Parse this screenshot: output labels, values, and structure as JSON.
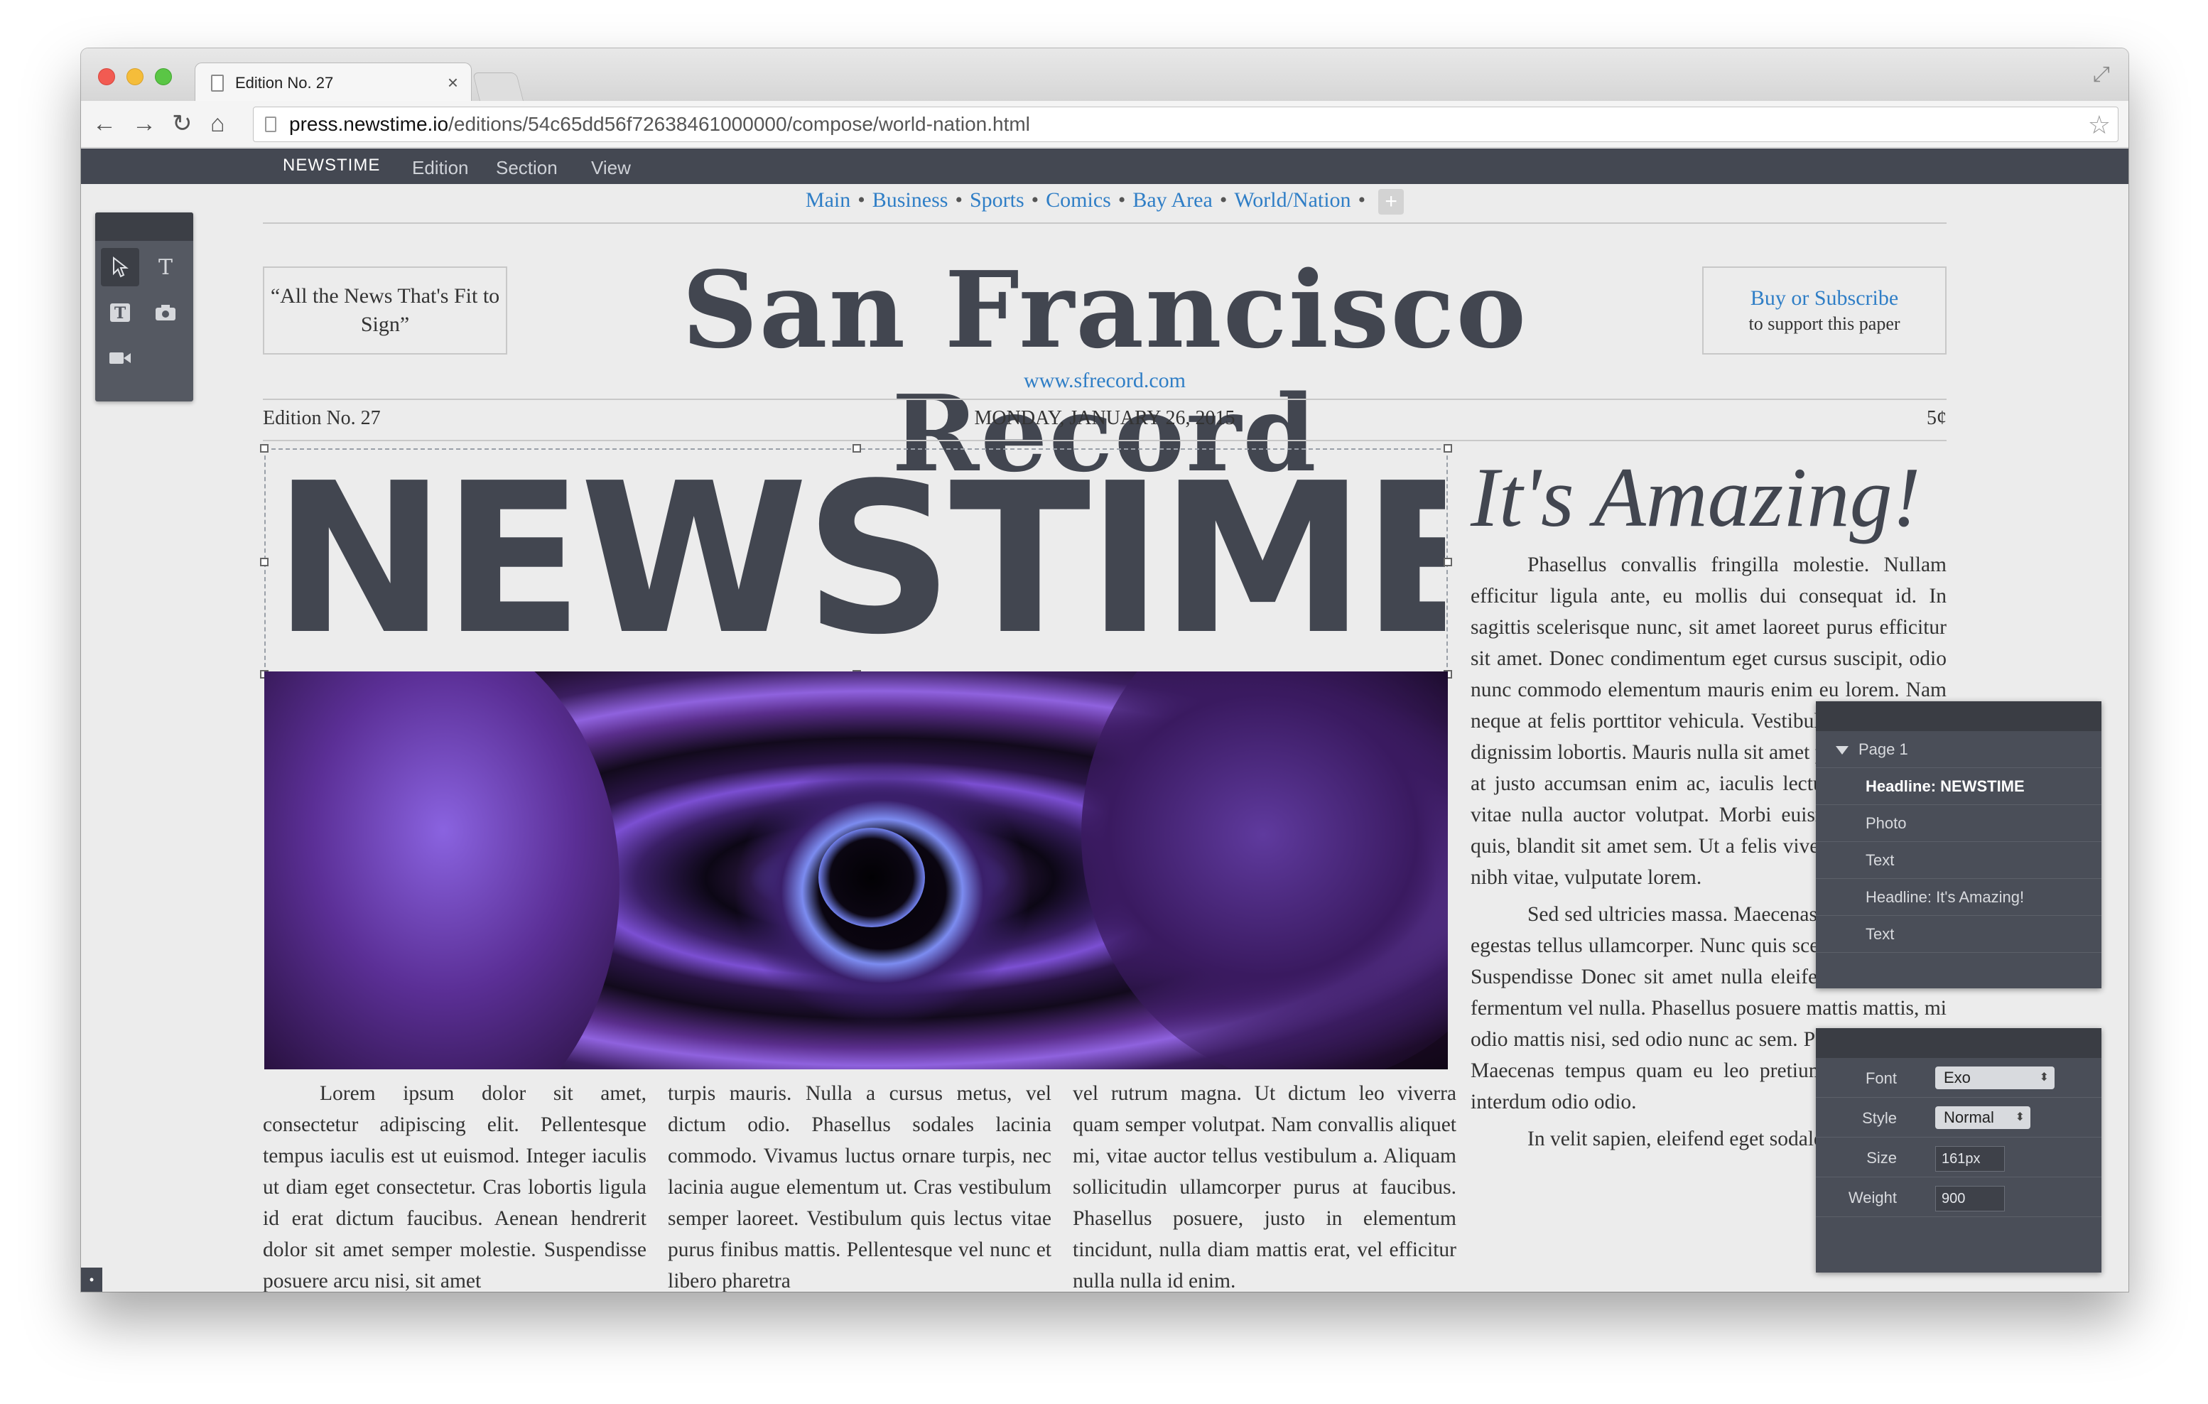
{
  "browser": {
    "tab_title": "Edition No. 27",
    "url_host": "press.newstime.io",
    "url_path": "/editions/54c65dd56f72638461000000/compose/world-nation.html"
  },
  "app": {
    "brand": "NEWSTIME",
    "menu": [
      "Edition",
      "Section",
      "View"
    ]
  },
  "tools": {
    "items": [
      "pointer-icon",
      "text-icon",
      "headline-tool-icon",
      "camera-icon",
      "video-icon"
    ]
  },
  "paper": {
    "sections": [
      "Main",
      "Business",
      "Sports",
      "Comics",
      "Bay Area",
      "World/Nation"
    ],
    "ear_left": "“All the News That's Fit to Sign”",
    "ear_right_link": "Buy or Subscribe",
    "ear_right_sub": "to support this paper",
    "masthead": "San Francisco Record",
    "site_url": "www.sfrecord.com",
    "edition": "Edition No. 27",
    "date": "MONDAY, JANUARY 26, 2015",
    "price": "5¢",
    "headline": "NEWSTIME",
    "col1": "Lorem ipsum dolor sit amet, consectetur adipiscing elit. Pellentesque tempus iaculis est ut euismod. Integer iaculis ut diam eget consectetur. Cras lobortis ligula id erat dictum faucibus. Aenean hendrerit dolor sit amet semper molestie. Suspendisse posuere arcu nisi, sit amet",
    "col2": "turpis mauris. Nulla a cursus metus, vel dictum odio. Phasellus sodales lacinia commodo. Vivamus luctus ornare turpis, nec lacinia augue elementum ut. Cras vestibulum semper laoreet. Vestibulum quis lectus vitae purus finibus mattis. Pellentesque vel nunc et libero pharetra",
    "col3": "vel rutrum magna. Ut dictum leo viverra quam semper volutpat. Nam convallis aliquet mi, vitae auctor tellus vestibulum a. Aliquam sollicitudin ullamcorper purus at faucibus. Phasellus posuere, justo in elementum tincidunt, nulla diam mattis erat, vel efficitur nulla nulla id enim.",
    "right_headline": "It's Amazing!",
    "right_p1": "Phasellus convallis fringilla molestie. Nullam efficitur ligula ante, eu mollis dui consequat id. In sagittis scelerisque nunc, sit amet laoreet purus efficitur sit amet. Donec condimentum eget cursus suscipit, odio nunc commodo elementum mauris enim eu lorem. Nam neque at felis porttitor vehicula. Vestibulum vitae tellus dignissim lobortis. Mauris nulla sit amet pulvinar. Morbi at justo accumsan enim ac, iaculis lectus. Proin quam vitae nulla auctor volutpat. Morbi euismod id dictum quis, blandit sit amet sem. Ut a felis viverra, elementum nibh vitae, vulputate lorem.",
    "right_p2": "Sed sed ultricies massa. Maecenas fringilla est, ut egestas tellus ullamcorper. Nunc quis scelerisque neque. Suspendisse Donec sit amet nulla eleifend nulla luctus fermentum vel nulla. Phasellus posuere mattis mattis, mi odio mattis nisi, sed odio nunc ac sem. Pellentesque non Maecenas tempus quam eu leo pretium. Pellentesque interdum odio odio.",
    "right_p3": "In velit sapien, eleifend eget sodales a, pharetra"
  },
  "layers": {
    "page": "Page 1",
    "items": [
      "Headline: NEWSTIME",
      "Photo",
      "Text",
      "Headline: It's Amazing!",
      "Text"
    ]
  },
  "props": {
    "font_label": "Font",
    "font_value": "Exo",
    "style_label": "Style",
    "style_value": "Normal",
    "size_label": "Size",
    "size_value": "161px",
    "weight_label": "Weight",
    "weight_value": "900"
  }
}
